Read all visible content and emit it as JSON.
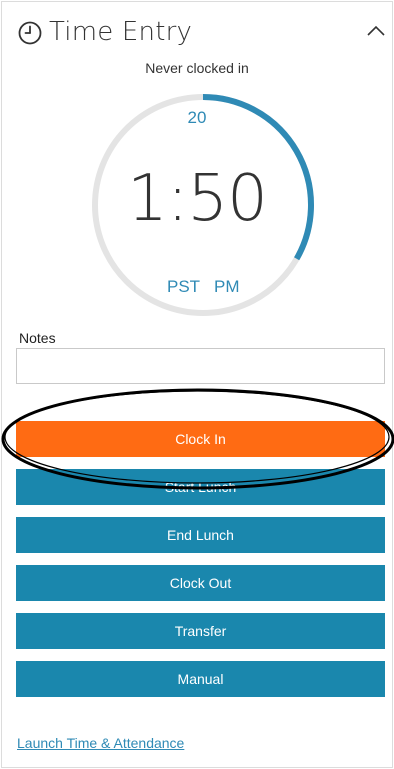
{
  "header": {
    "title": "Time Entry",
    "icon": "clock-icon",
    "collapse_icon": "chevron-up-icon"
  },
  "status_text": "Never clocked in",
  "dial": {
    "seconds": "20",
    "time": "1:50",
    "timezone": "PST",
    "ampm": "PM",
    "progress_fraction": 0.333,
    "accent_color": "#2f8ab5",
    "track_color": "#e4e4e4"
  },
  "notes": {
    "label": "Notes",
    "value": "",
    "placeholder": ""
  },
  "buttons": {
    "clock_in": "Clock In",
    "start_lunch": "Start Lunch",
    "end_lunch": "End Lunch",
    "clock_out": "Clock Out",
    "transfer": "Transfer",
    "manual": "Manual"
  },
  "colors": {
    "primary_button": "#ff6b13",
    "secondary_button": "#1a87ad"
  },
  "footer": {
    "link_label": "Launch Time & Attendance"
  }
}
